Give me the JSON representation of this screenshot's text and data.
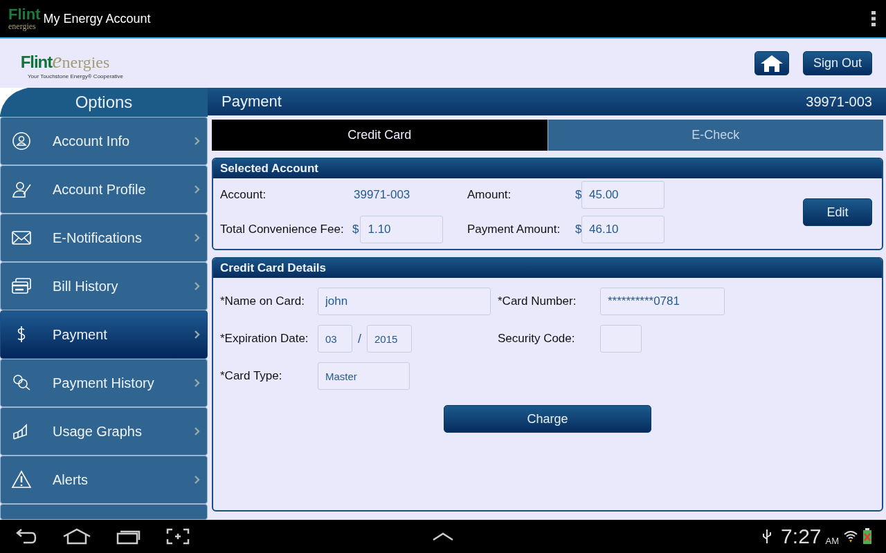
{
  "app_bar": {
    "logo_top": "Flint",
    "logo_bottom": "energies",
    "title": "My Energy Account"
  },
  "header": {
    "logo_word1": "Flint",
    "logo_word2": "energies",
    "tagline": "Your Touchstone Energy® Cooperative",
    "sign_out": "Sign Out"
  },
  "sidebar": {
    "title": "Options",
    "items": [
      {
        "label": "Account Info",
        "selected": false
      },
      {
        "label": "Account Profile",
        "selected": false
      },
      {
        "label": "E-Notifications",
        "selected": false
      },
      {
        "label": "Bill History",
        "selected": false
      },
      {
        "label": "Payment",
        "selected": true
      },
      {
        "label": "Payment History",
        "selected": false
      },
      {
        "label": "Usage Graphs",
        "selected": false
      },
      {
        "label": "Alerts",
        "selected": false
      }
    ]
  },
  "page": {
    "title": "Payment",
    "account_number": "39971-003"
  },
  "tabs": [
    {
      "label": "Credit Card",
      "selected": true
    },
    {
      "label": "E-Check",
      "selected": false
    }
  ],
  "selected_account": {
    "title": "Selected Account",
    "account_label": "Account:",
    "account_value": "39971-003",
    "amount_label": "Amount:",
    "amount_currency": "$",
    "amount_value": "45.00",
    "fee_label": "Total Convenience Fee:",
    "fee_currency": "$",
    "fee_value": "1.10",
    "payment_label": "Payment Amount:",
    "payment_currency": "$",
    "payment_value": "46.10",
    "edit_button": "Edit"
  },
  "card_details": {
    "title": "Credit Card Details",
    "name_label": "*Name on Card:",
    "name_value": "john",
    "number_label": "*Card Number:",
    "number_value": "**********0781",
    "expiry_label": "*Expiration Date:",
    "expiry_month": "03",
    "expiry_separator": "/",
    "expiry_year": "2015",
    "security_label": "Security Code:",
    "type_label": "*Card Type:",
    "type_value": "Master",
    "charge_button": "Charge"
  },
  "status_bar": {
    "time": "7:27",
    "ampm": "AM"
  }
}
